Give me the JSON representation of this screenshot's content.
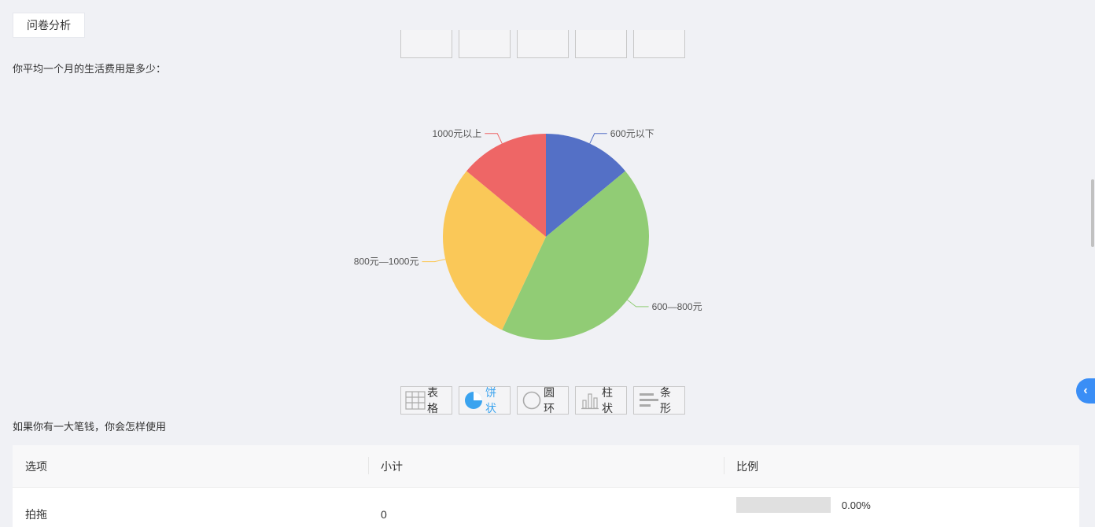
{
  "header": {
    "tab_label": "问卷分析"
  },
  "question1": {
    "title": "你平均一个月的生活费用是多少："
  },
  "question2": {
    "title": "如果你有一大笔钱，你会怎样使用"
  },
  "toolbar": {
    "table_label": "表格",
    "pie_label": "饼状",
    "ring_label": "圆环",
    "column_label": "柱状",
    "bar_label": "条形",
    "active": "pie",
    "active_color": "#3aa3ef"
  },
  "chart_data": {
    "type": "pie",
    "slices": [
      {
        "label": "600元以下",
        "value": 14,
        "color": "#5470c6"
      },
      {
        "label": "600—800元",
        "value": 43,
        "color": "#91cc75"
      },
      {
        "label": "800元—1000元",
        "value": 29,
        "color": "#fac858"
      },
      {
        "label": "1000元以上",
        "value": 14,
        "color": "#ee6666"
      }
    ]
  },
  "table": {
    "headers": [
      "选项",
      "小计",
      "比例"
    ],
    "rows": [
      {
        "option": "拍拖",
        "count": "0",
        "ratio": "0.00%",
        "ratio_value": 0
      }
    ]
  },
  "side_button": {
    "icon": "chevron-left-icon",
    "color": "#3a8ef6"
  }
}
